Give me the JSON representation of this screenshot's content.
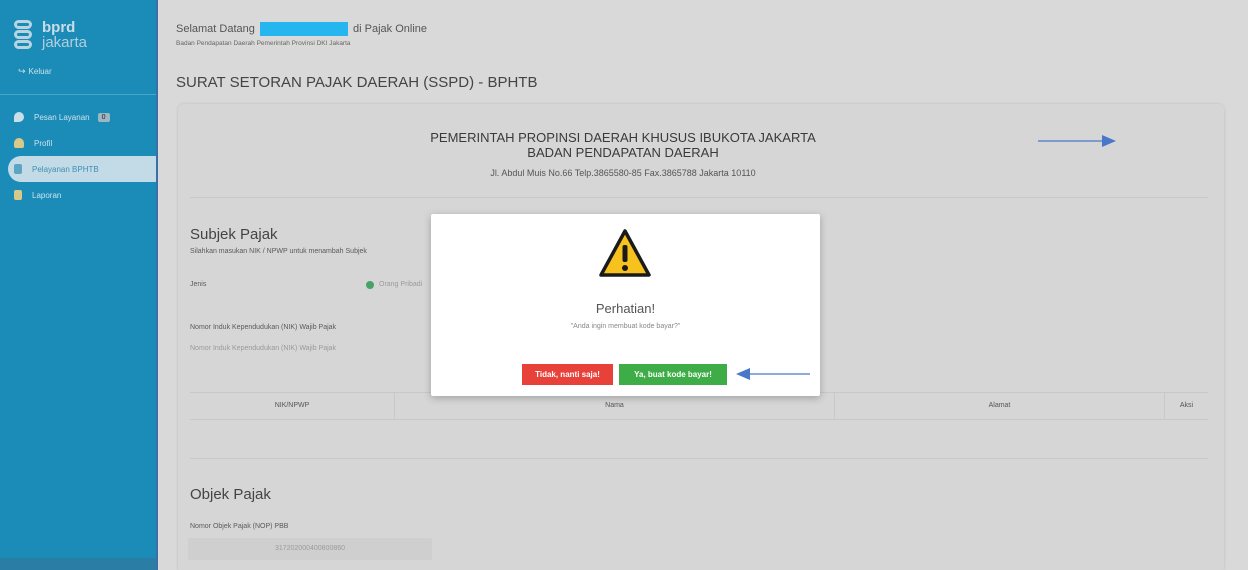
{
  "sidebar": {
    "logo_line1": "bprd",
    "logo_line2": "jakarta",
    "logout_label": "Keluar",
    "items": [
      {
        "label": "Pesan Layanan",
        "badge": "0",
        "icon": "messages-icon"
      },
      {
        "label": "Profil",
        "icon": "user-icon"
      },
      {
        "label": "Pelayanan BPHTB",
        "icon": "document-icon"
      },
      {
        "label": "Laporan",
        "icon": "report-icon"
      }
    ]
  },
  "header": {
    "welcome_prefix": "Selamat Datang",
    "welcome_suffix": "di Pajak Online",
    "subtitle": "Badan Pendapatan Daerah Pemerintah Provinsi DKI Jakarta",
    "page_title": "SURAT SETORAN PAJAK DAERAH (SSPD) - BPHTB"
  },
  "letterhead": {
    "line1": "PEMERINTAH PROPINSI DAERAH KHUSUS IBUKOTA JAKARTA",
    "line2": "BADAN PENDAPATAN DAERAH",
    "address": "Jl. Abdul Muis No.66 Telp.3865580-85 Fax.3865788 Jakarta 10110"
  },
  "subjek": {
    "title": "Subjek Pajak",
    "hint": "Silahkan masukan NIK / NPWP untuk menambah Subjek",
    "jenis_label": "Jenis",
    "radio_label": "Orang Pribadi",
    "nik_label": "Nomor Induk Kependudukan (NIK) Wajib Pajak",
    "nik_placeholder": "Nomor Induk Kependudukan (NIK) Wajib Pajak"
  },
  "table": {
    "headers": [
      "NIK/NPWP",
      "Nama",
      "Alamat",
      "Aksi"
    ]
  },
  "objek": {
    "title": "Objek Pajak",
    "nop_label": "Nomor Objek Pajak (NOP) PBB",
    "nop_value": "317202000400800860"
  },
  "modal": {
    "title": "Perhatian!",
    "message": "\"Anda ingin membuat kode bayar?\"",
    "cancel_label": "Tidak, nanti saja!",
    "confirm_label": "Ya, buat kode bayar!"
  },
  "colors": {
    "sidebar": "#1b8bb8",
    "annotation_arrow": "#4a78c8",
    "cancel": "#e7413a",
    "confirm": "#3ead48",
    "warning": "#f7c21d"
  }
}
